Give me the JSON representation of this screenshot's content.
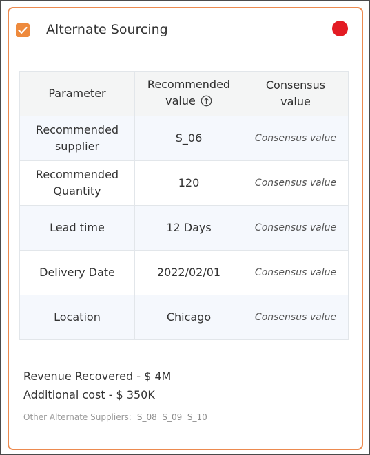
{
  "card": {
    "title": "Alternate Sourcing",
    "checked": true,
    "accent_color": "#ee8a3d",
    "border_color": "#ec8a4f",
    "status_color": "#e31b23"
  },
  "table": {
    "headers": {
      "parameter": "Parameter",
      "recommended_line1": "Recommended",
      "recommended_line2": "value",
      "consensus_line1": "Consensus",
      "consensus_line2": "value"
    },
    "rows": [
      {
        "param_line1": "Recommended",
        "param_line2": "supplier",
        "value": "S_06",
        "consensus": "Consensus value"
      },
      {
        "param_line1": "Recommended",
        "param_line2": "Quantity",
        "value": "120",
        "consensus": "Consensus value"
      },
      {
        "param_line1": "Lead time",
        "param_line2": "",
        "value": "12 Days",
        "consensus": "Consensus value"
      },
      {
        "param_line1": "Delivery Date",
        "param_line2": "",
        "value": "2022/02/01",
        "consensus": "Consensus value"
      },
      {
        "param_line1": "Location",
        "param_line2": "",
        "value": "Chicago",
        "consensus": "Consensus value"
      }
    ]
  },
  "summary": {
    "revenue": "Revenue Recovered - $ 4M",
    "cost": "Additional cost - $ 350K"
  },
  "other_suppliers": {
    "label": "Other Alternate Suppliers:",
    "links": "S_08  S_09  S_10"
  }
}
